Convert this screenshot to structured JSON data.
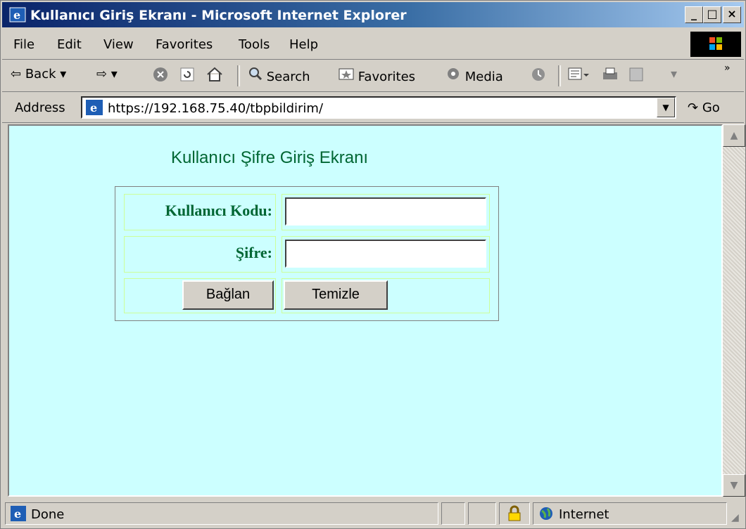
{
  "window": {
    "title": "Kullanıcı Giriş Ekranı - Microsoft Internet Explorer"
  },
  "menu": {
    "items": [
      "File",
      "Edit",
      "View",
      "Favorites",
      "Tools",
      "Help"
    ]
  },
  "toolbar": {
    "back": "Back",
    "search": "Search",
    "favorites": "Favorites",
    "media": "Media"
  },
  "address": {
    "label": "Address",
    "url": "https://192.168.75.40/tbpbildirim/",
    "go": "Go"
  },
  "page": {
    "title": "Kullanıcı Şifre Giriş Ekranı",
    "username_label": "Kullanıcı Kodu:",
    "password_label": "Şifre:",
    "username_value": "",
    "password_value": "",
    "connect_button": "Bağlan",
    "clear_button": "Temizle"
  },
  "status": {
    "text": "Done",
    "zone": "Internet"
  },
  "colors": {
    "page_bg": "#ccffff",
    "heading": "#006633",
    "title_bar": "#0a246a"
  }
}
